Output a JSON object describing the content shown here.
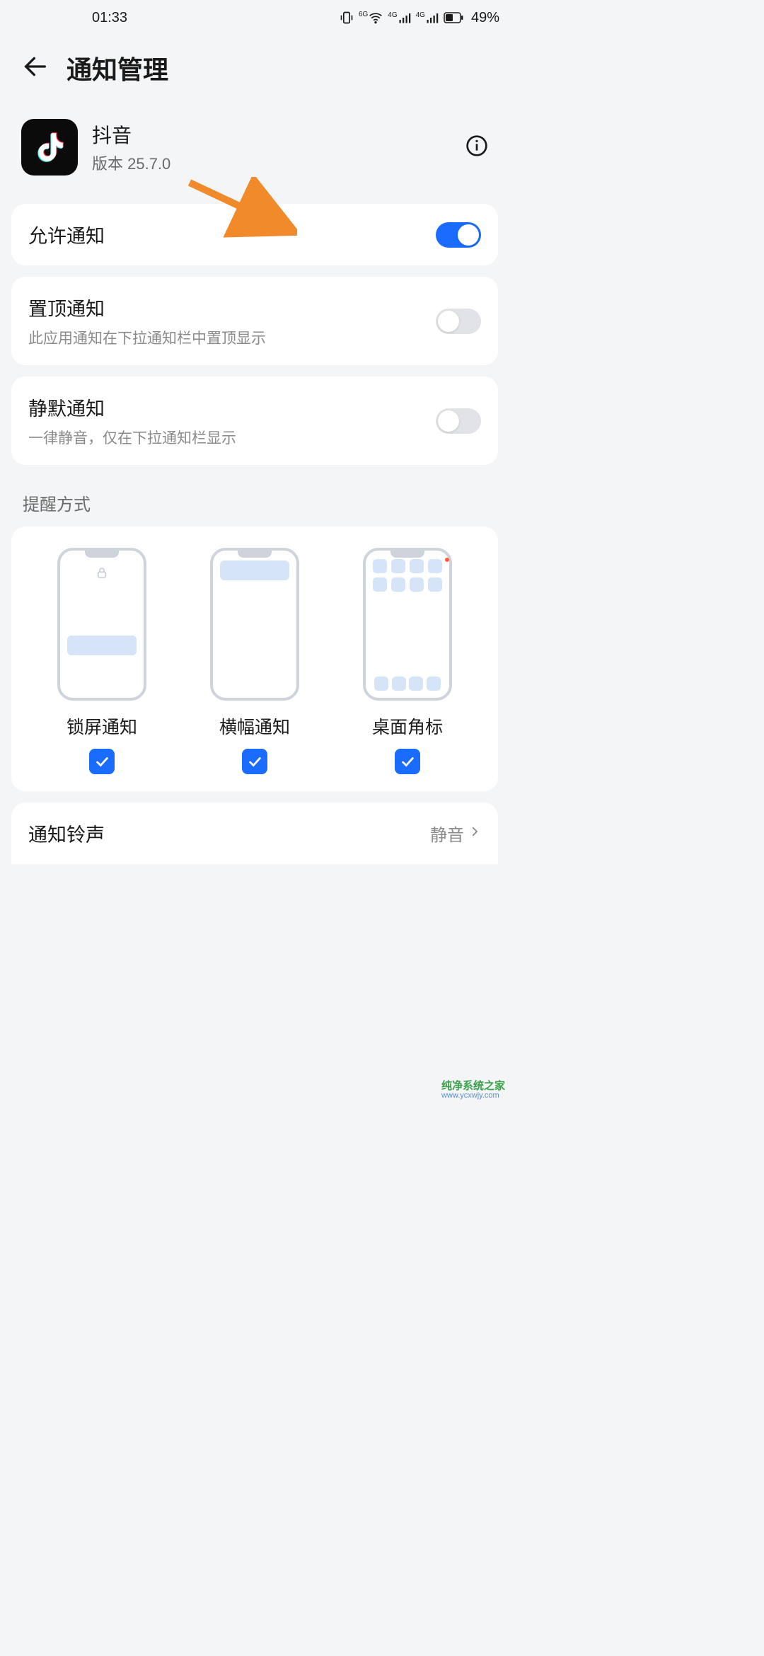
{
  "status": {
    "time": "01:33",
    "signal_6g": "6G",
    "signal_4g_1": "4G",
    "signal_4g_2": "4G",
    "battery_percent": "49%"
  },
  "page": {
    "title": "通知管理"
  },
  "app": {
    "name": "抖音",
    "version": "版本 25.7.0"
  },
  "toggles": {
    "allow": {
      "title": "允许通知",
      "on": true
    },
    "top": {
      "title": "置顶通知",
      "sub": "此应用通知在下拉通知栏中置顶显示",
      "on": false
    },
    "silent": {
      "title": "静默通知",
      "sub": "一律静音，仅在下拉通知栏显示",
      "on": false
    }
  },
  "styles": {
    "section_label": "提醒方式",
    "lock": {
      "label": "锁屏通知",
      "checked": true
    },
    "banner": {
      "label": "横幅通知",
      "checked": true
    },
    "badge": {
      "label": "桌面角标",
      "checked": true
    }
  },
  "ringtone": {
    "label": "通知铃声",
    "value": "静音"
  },
  "watermark": {
    "top": "纯净系统之家",
    "sub": "www.ycxwjy.com"
  }
}
